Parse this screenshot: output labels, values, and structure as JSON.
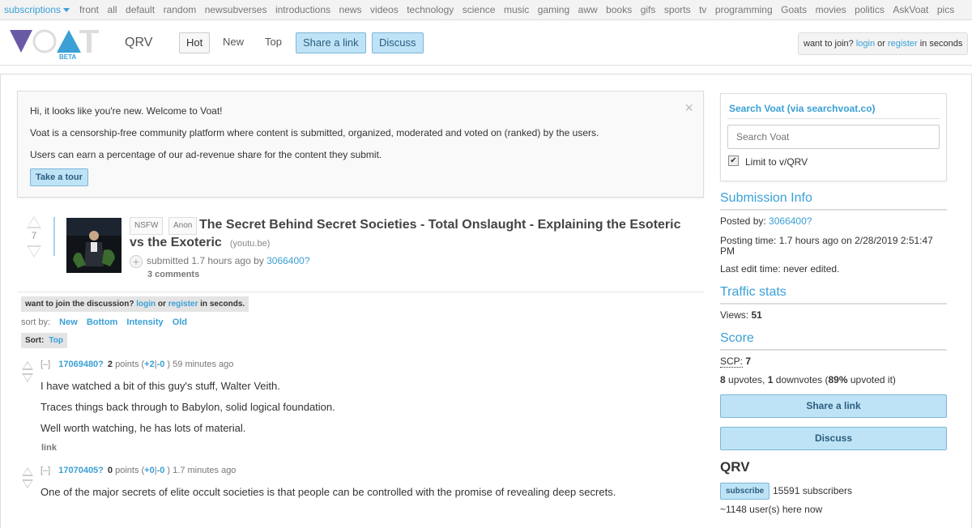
{
  "topbar": {
    "subscriptions": "subscriptions",
    "links": [
      "front",
      "all",
      "default",
      "random",
      "newsubverses",
      "introductions",
      "news",
      "videos",
      "technology",
      "science",
      "music",
      "gaming",
      "aww",
      "books",
      "gifs",
      "sports",
      "tv",
      "programming",
      "Goats",
      "movies",
      "politics",
      "AskVoat",
      "pics"
    ]
  },
  "header": {
    "logo_badge": "BETA",
    "subverse": "QRV",
    "tabs": {
      "hot": "Hot",
      "new": "New",
      "top": "Top"
    },
    "share_link": "Share a link",
    "discuss": "Discuss",
    "join": {
      "prefix": "want to join?",
      "login": "login",
      "or": "or",
      "register": "register",
      "suffix": "in seconds"
    }
  },
  "welcome": {
    "line1": "Hi, it looks like you're new. Welcome to Voat!",
    "line2": "Voat is a censorship-free community platform where content is submitted, organized, moderated and voted on (ranked) by the users.",
    "line3": "Users can earn a percentage of our ad-revenue share for the content they submit.",
    "tour": "Take a tour",
    "close": "×"
  },
  "submission": {
    "score": "7",
    "badges": [
      "NSFW",
      "Anon"
    ],
    "title": "The Secret Behind Secret Societies - Total Onslaught - Explaining the Esoteric vs the Exoteric",
    "domain": "(youtu.be)",
    "submitted": "submitted 1.7 hours ago by",
    "author": "3066400?",
    "comments": "3 comments"
  },
  "discussion": {
    "join_prefix": "want to join the discussion?",
    "login": "login",
    "or": "or",
    "register": "register",
    "join_suffix": "in seconds.",
    "sort_by": "sort by:",
    "sort_options": [
      "New",
      "Bottom",
      "Intensity",
      "Old"
    ],
    "sort_label": "Sort:",
    "sort_current": "Top"
  },
  "comments": [
    {
      "toggle": "[–]",
      "user": "17069480?",
      "points": "2",
      "points_label": "points (",
      "up": "+2",
      "sep": "|",
      "down": "-0",
      "close": ")",
      "time": "59 minutes ago",
      "lines": [
        "I have watched a bit of this guy's stuff, Walter Veith.",
        "Traces things back through to Babylon, solid logical foundation.",
        "Well worth watching, he has lots of material."
      ],
      "link": "link"
    },
    {
      "toggle": "[–]",
      "user": "17070405?",
      "points": "0",
      "points_label": "points (",
      "up": "+0",
      "sep": "|",
      "down": "-0",
      "close": ")",
      "time": "1.7 minutes ago",
      "lines": [
        "One of the major secrets of elite occult societies is that people can be controlled with the promise of revealing deep secrets."
      ]
    }
  ],
  "sidebar": {
    "search_title": "Search Voat (via searchvoat.co)",
    "search_placeholder": "Search Voat",
    "limit_label": "Limit to v/QRV",
    "submission_info": "Submission Info",
    "posted_by_label": "Posted by:",
    "posted_by": "3066400?",
    "posting_time": "Posting time: 1.7 hours ago on 2/28/2019 2:51:47 PM",
    "last_edit": "Last edit time: never edited.",
    "traffic_stats": "Traffic stats",
    "views_label": "Views:",
    "views": "51",
    "score_heading": "Score",
    "scp_label": "SCP:",
    "scp": "7",
    "upvotes": "8",
    "upvotes_label": "upvotes,",
    "downvotes": "1",
    "downvotes_label": "downvotes (",
    "upvoted_pct": "89%",
    "upvoted_label": "upvoted it)",
    "share_link": "Share a link",
    "discuss": "Discuss",
    "subverse": "QRV",
    "subscribe": "subscribe",
    "subscribers": "15591 subscribers",
    "here_now": "~1148 user(s) here now"
  },
  "colors": {
    "accent": "#3aa0d6",
    "button_bg": "#bfe3f6",
    "logo_purple": "#6a5aa6",
    "logo_blue": "#3aa0d6"
  }
}
